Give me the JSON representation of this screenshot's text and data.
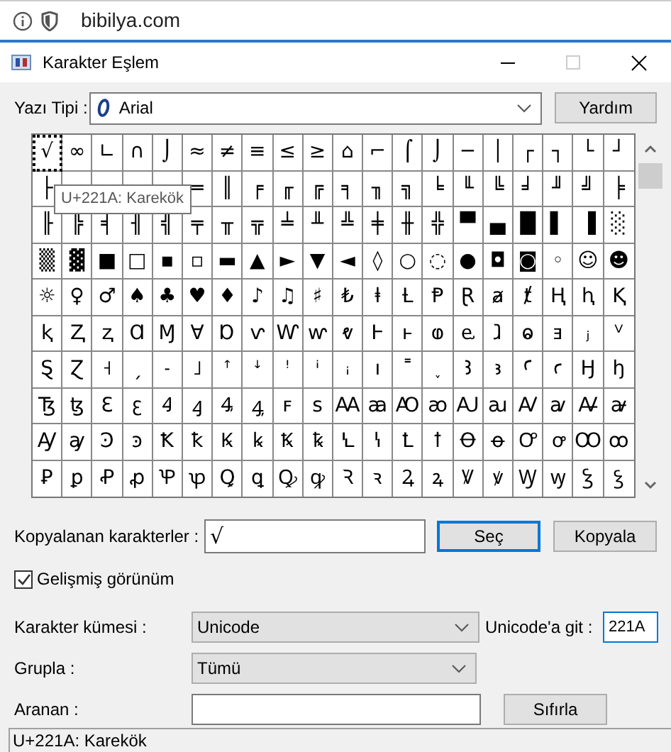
{
  "browser": {
    "address": "bibilya.com"
  },
  "window": {
    "title": "Karakter Eşlem"
  },
  "font": {
    "label": "Yazı Tipi :",
    "value": "Arial"
  },
  "help_button": "Yardım",
  "grid": {
    "rows": [
      [
        {
          "char": "√",
          "selected": true
        },
        {
          "char": "∞",
          "selected": false
        },
        {
          "char": "∟",
          "selected": false
        },
        {
          "char": "∩",
          "selected": false
        },
        {
          "char": "⌡",
          "selected": false
        },
        {
          "char": "≈",
          "selected": false
        },
        {
          "char": "≠",
          "selected": false
        },
        {
          "char": "≡",
          "selected": false
        },
        {
          "char": "≤",
          "selected": false
        },
        {
          "char": "≥",
          "selected": false
        },
        {
          "char": "⌂",
          "selected": false
        },
        {
          "char": "⌐",
          "selected": false
        },
        {
          "char": "⌠",
          "selected": false
        },
        {
          "char": "⌡",
          "selected": false
        },
        {
          "char": "─",
          "selected": false
        },
        {
          "char": "│",
          "selected": false
        },
        {
          "char": "┌",
          "selected": false
        },
        {
          "char": "┐",
          "selected": false
        },
        {
          "char": "└",
          "selected": false
        },
        {
          "char": "┘",
          "selected": false
        }
      ],
      [
        {
          "char": "├",
          "selected": false
        },
        {
          "selected": false
        },
        {
          "selected": false
        },
        {
          "selected": false
        },
        {
          "selected": false
        },
        {
          "char": "═",
          "selected": false
        },
        {
          "char": "║",
          "selected": false
        },
        {
          "char": "╒",
          "selected": false
        },
        {
          "char": "╓",
          "selected": false
        },
        {
          "char": "╔",
          "selected": false
        },
        {
          "char": "╕",
          "selected": false
        },
        {
          "char": "╖",
          "selected": false
        },
        {
          "char": "╗",
          "selected": false
        },
        {
          "char": "╘",
          "selected": false
        },
        {
          "char": "╙",
          "selected": false
        },
        {
          "char": "╚",
          "selected": false
        },
        {
          "char": "╛",
          "selected": false
        },
        {
          "char": "╜",
          "selected": false
        },
        {
          "char": "╝",
          "selected": false
        },
        {
          "char": "╞",
          "selected": false
        }
      ],
      [
        {
          "char": "╟",
          "selected": false
        },
        {
          "char": "╠",
          "selected": false
        },
        {
          "char": "╡",
          "selected": false
        },
        {
          "char": "╢",
          "selected": false
        },
        {
          "char": "╣",
          "selected": false
        },
        {
          "char": "╤",
          "selected": false
        },
        {
          "char": "╥",
          "selected": false
        },
        {
          "char": "╦",
          "selected": false
        },
        {
          "char": "╧",
          "selected": false
        },
        {
          "char": "╨",
          "selected": false
        },
        {
          "char": "╩",
          "selected": false
        },
        {
          "char": "╪",
          "selected": false
        },
        {
          "char": "╫",
          "selected": false
        },
        {
          "char": "╬",
          "selected": false
        },
        {
          "char": "▀",
          "selected": false
        },
        {
          "char": "▄",
          "selected": false
        },
        {
          "char": "█",
          "selected": false
        },
        {
          "char": "▌",
          "selected": false
        },
        {
          "char": "▐",
          "selected": false
        },
        {
          "char": "░",
          "selected": false
        }
      ],
      [
        {
          "char": "▒",
          "selected": false
        },
        {
          "char": "▓",
          "selected": false
        },
        {
          "char": "■",
          "selected": false
        },
        {
          "char": "□",
          "selected": false
        },
        {
          "char": "▪",
          "selected": false
        },
        {
          "char": "▫",
          "selected": false
        },
        {
          "char": "▬",
          "selected": false
        },
        {
          "char": "▲",
          "selected": false
        },
        {
          "char": "►",
          "selected": false
        },
        {
          "char": "▼",
          "selected": false
        },
        {
          "char": "◄",
          "selected": false
        },
        {
          "char": "◊",
          "selected": false
        },
        {
          "char": "○",
          "selected": false
        },
        {
          "char": "◌",
          "selected": false
        },
        {
          "char": "●",
          "selected": false
        },
        {
          "char": "◘",
          "selected": false
        },
        {
          "char": "◙",
          "selected": false
        },
        {
          "char": "◦",
          "selected": false
        },
        {
          "char": "☺",
          "selected": false
        },
        {
          "char": "☻",
          "selected": false
        }
      ],
      [
        {
          "char": "☼",
          "selected": false
        },
        {
          "char": "♀",
          "selected": false
        },
        {
          "char": "♂",
          "selected": false
        },
        {
          "char": "♠",
          "selected": false
        },
        {
          "char": "♣",
          "selected": false
        },
        {
          "char": "♥",
          "selected": false
        },
        {
          "char": "♦",
          "selected": false
        },
        {
          "char": "♪",
          "selected": false
        },
        {
          "char": "♫",
          "selected": false
        },
        {
          "char": "♯",
          "selected": false
        },
        {
          "char": "₺",
          "selected": false
        },
        {
          "char": "ⱡ",
          "selected": false
        },
        {
          "char": "Ƚ",
          "selected": false
        },
        {
          "char": "Ᵽ",
          "selected": false
        },
        {
          "char": "Ɽ",
          "selected": false
        },
        {
          "char": "ⱥ",
          "selected": false
        },
        {
          "char": "ⱦ",
          "selected": false
        },
        {
          "char": "Ⱨ",
          "selected": false
        },
        {
          "char": "ⱨ",
          "selected": false
        },
        {
          "char": "Ⱪ",
          "selected": false
        }
      ],
      [
        {
          "char": "ⱪ",
          "selected": false
        },
        {
          "char": "Ⱬ",
          "selected": false
        },
        {
          "char": "ⱬ",
          "selected": false
        },
        {
          "char": "Ɑ",
          "selected": false
        },
        {
          "char": "Ɱ",
          "selected": false
        },
        {
          "char": "Ɐ",
          "selected": false
        },
        {
          "char": "Ɒ",
          "selected": false
        },
        {
          "char": "ⱱ",
          "selected": false
        },
        {
          "char": "Ⱳ",
          "selected": false
        },
        {
          "char": "ⱳ",
          "selected": false
        },
        {
          "char": "ⱴ",
          "selected": false
        },
        {
          "char": "Ⱶ",
          "selected": false
        },
        {
          "char": "ⱶ",
          "selected": false
        },
        {
          "char": "ⱷ",
          "selected": false
        },
        {
          "char": "ⱸ",
          "selected": false
        },
        {
          "char": "ⱹ",
          "selected": false
        },
        {
          "char": "ⱺ",
          "selected": false
        },
        {
          "char": "ⱻ",
          "selected": false
        },
        {
          "char": "ⱼ",
          "selected": false
        },
        {
          "char": "ⱽ",
          "selected": false
        }
      ],
      [
        {
          "char": "Ȿ",
          "selected": false
        },
        {
          "char": "Ɀ",
          "selected": false
        },
        {
          "char": "˧",
          "selected": false
        },
        {
          "char": "ˏ",
          "selected": false
        },
        {
          "char": "˗",
          "selected": false
        },
        {
          "char": "˩",
          "selected": false
        },
        {
          "char": "ꜛ",
          "selected": false
        },
        {
          "char": "ꜜ",
          "selected": false
        },
        {
          "char": "ꜝ",
          "selected": false
        },
        {
          "char": "ꜞ",
          "selected": false
        },
        {
          "char": "ꜟ",
          "selected": false
        },
        {
          "char": "ı",
          "selected": false
        },
        {
          "char": "˭",
          "selected": false
        },
        {
          "char": "˯",
          "selected": false
        },
        {
          "char": "Ꜣ",
          "selected": false
        },
        {
          "char": "ꜣ",
          "selected": false
        },
        {
          "char": "Ꜥ",
          "selected": false
        },
        {
          "char": "ꜥ",
          "selected": false
        },
        {
          "char": "Ꜧ",
          "selected": false
        },
        {
          "char": "ꜧ",
          "selected": false
        }
      ],
      [
        {
          "char": "Ꜩ",
          "selected": false
        },
        {
          "char": "ꜩ",
          "selected": false
        },
        {
          "char": "Ꜫ",
          "selected": false
        },
        {
          "char": "ꜫ",
          "selected": false
        },
        {
          "char": "Ꜭ",
          "selected": false
        },
        {
          "char": "ꜭ",
          "selected": false
        },
        {
          "char": "Ꜯ",
          "selected": false
        },
        {
          "char": "ꜯ",
          "selected": false
        },
        {
          "char": "ꜰ",
          "selected": false
        },
        {
          "char": "ꜱ",
          "selected": false
        },
        {
          "char": "Ꜳ",
          "selected": false
        },
        {
          "char": "ꜳ",
          "selected": false
        },
        {
          "char": "Ꜵ",
          "selected": false
        },
        {
          "char": "ꜵ",
          "selected": false
        },
        {
          "char": "Ꜷ",
          "selected": false
        },
        {
          "char": "ꜷ",
          "selected": false
        },
        {
          "char": "Ꜹ",
          "selected": false
        },
        {
          "char": "ꜹ",
          "selected": false
        },
        {
          "char": "Ꜻ",
          "selected": false
        },
        {
          "char": "ꜻ",
          "selected": false
        }
      ],
      [
        {
          "char": "Ꜽ",
          "selected": false
        },
        {
          "char": "ꜽ",
          "selected": false
        },
        {
          "char": "Ꜿ",
          "selected": false
        },
        {
          "char": "ꜿ",
          "selected": false
        },
        {
          "char": "Ꝁ",
          "selected": false
        },
        {
          "char": "ꝁ",
          "selected": false
        },
        {
          "char": "Ꝃ",
          "selected": false
        },
        {
          "char": "ꝃ",
          "selected": false
        },
        {
          "char": "Ꝅ",
          "selected": false
        },
        {
          "char": "ꝅ",
          "selected": false
        },
        {
          "char": "Ꝇ",
          "selected": false
        },
        {
          "char": "ꝇ",
          "selected": false
        },
        {
          "char": "Ꝉ",
          "selected": false
        },
        {
          "char": "ꝉ",
          "selected": false
        },
        {
          "char": "Ꝋ",
          "selected": false
        },
        {
          "char": "ꝋ",
          "selected": false
        },
        {
          "char": "Ꝍ",
          "selected": false
        },
        {
          "char": "ꝍ",
          "selected": false
        },
        {
          "char": "Ꝏ",
          "selected": false
        },
        {
          "char": "ꝏ",
          "selected": false
        }
      ],
      [
        {
          "char": "Ꝑ",
          "selected": false
        },
        {
          "char": "ꝑ",
          "selected": false
        },
        {
          "char": "Ꝓ",
          "selected": false
        },
        {
          "char": "ꝓ",
          "selected": false
        },
        {
          "char": "Ꝕ",
          "selected": false
        },
        {
          "char": "ꝕ",
          "selected": false
        },
        {
          "char": "Ꝗ",
          "selected": false
        },
        {
          "char": "ꝗ",
          "selected": false
        },
        {
          "char": "Ꝙ",
          "selected": false
        },
        {
          "char": "ꝙ",
          "selected": false
        },
        {
          "char": "Ꝛ",
          "selected": false
        },
        {
          "char": "ꝛ",
          "selected": false
        },
        {
          "char": "Ꝝ",
          "selected": false
        },
        {
          "char": "ꝝ",
          "selected": false
        },
        {
          "char": "Ꝟ",
          "selected": false
        },
        {
          "char": "ꝟ",
          "selected": false
        },
        {
          "char": "Ꝡ",
          "selected": false
        },
        {
          "char": "ꝡ",
          "selected": false
        },
        {
          "char": "Ꝣ",
          "selected": false
        },
        {
          "char": "ꝣ",
          "selected": false
        }
      ]
    ],
    "tooltip": "U+221A: Karekök"
  },
  "copy": {
    "label": "Kopyalanan karakterler :",
    "value": "√",
    "select_button": "Seç",
    "copy_button": "Kopyala"
  },
  "advanced": {
    "label": "Gelişmiş görünüm",
    "checked": true
  },
  "charset": {
    "label": "Karakter kümesi :",
    "value": "Unicode"
  },
  "goto": {
    "label": "Unicode'a git :",
    "value": "221A"
  },
  "group": {
    "label": "Grupla :",
    "value": "Tümü"
  },
  "search": {
    "label": "Aranan :",
    "button": "Sıfırla"
  },
  "status_bar": "U+221A: Karekök"
}
